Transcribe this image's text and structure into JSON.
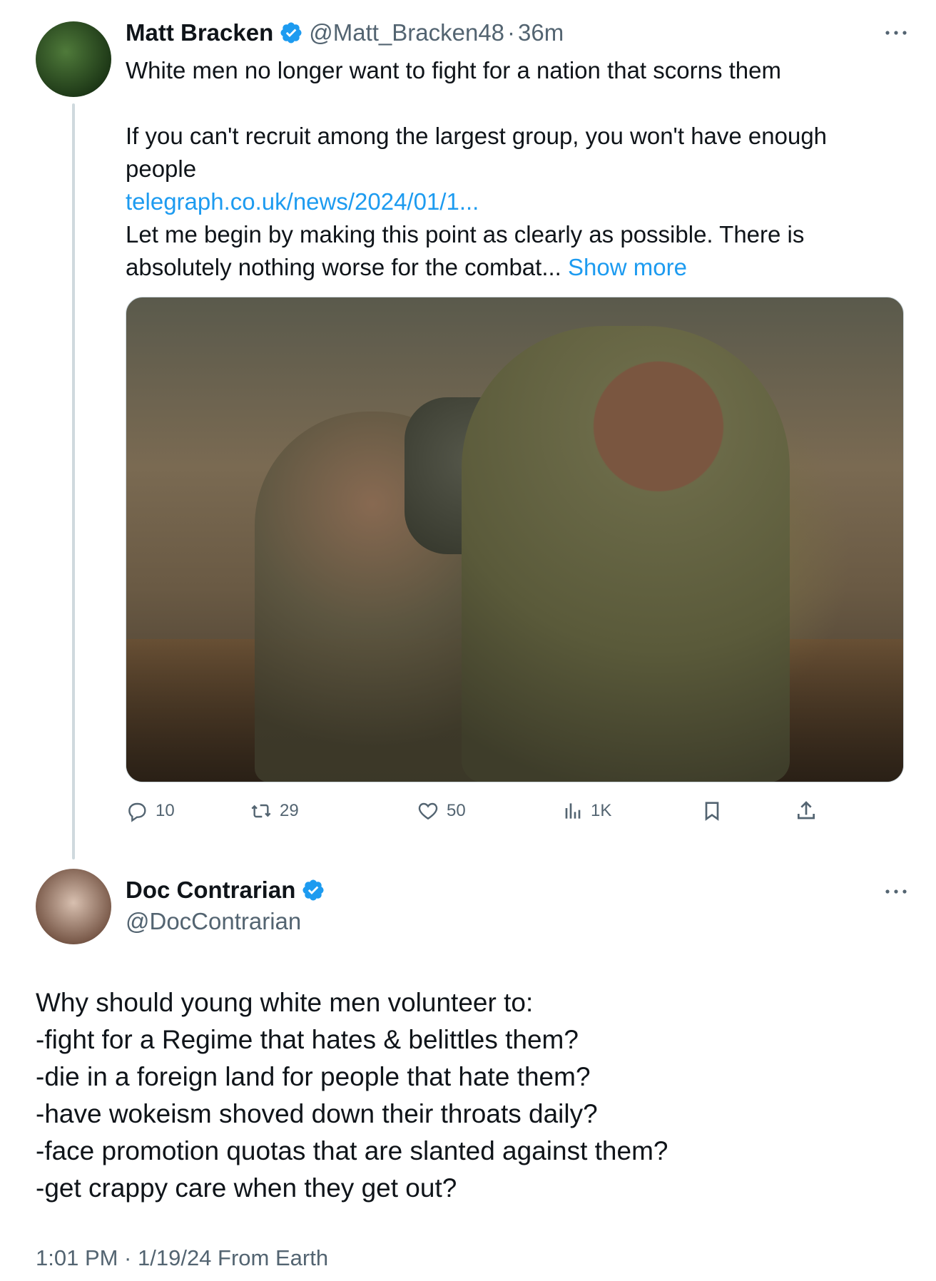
{
  "tweet1": {
    "author_name": "Matt Bracken",
    "handle": "@Matt_Bracken48",
    "separator": "·",
    "time": "36m",
    "line1": "White men no longer want to fight for a nation that scorns them",
    "line2": "If you can't recruit among the largest group, you won't have enough people",
    "link": "telegraph.co.uk/news/2024/01/1...",
    "excerpt": "Let me begin by making this point as clearly as possible. There is absolutely nothing worse for the combat...",
    "show_more": "Show more",
    "actions": {
      "replies": "10",
      "reposts": "29",
      "likes": "50",
      "views": "1K"
    }
  },
  "tweet2": {
    "author_name": "Doc Contrarian",
    "handle": "@DocContrarian",
    "lines": [
      "Why should young white men volunteer to:",
      "-fight for a Regime that hates & belittles them?",
      "-die in a foreign land for people that hate them?",
      "-have wokeism shoved down their throats daily?",
      "-face promotion quotas that are slanted against them?",
      "-get crappy care when they get out?"
    ],
    "meta": "1:01 PM · 1/19/24 From Earth"
  },
  "icons": [
    "more-icon",
    "verified-badge-icon",
    "reply-icon",
    "repost-icon",
    "like-icon",
    "views-icon",
    "bookmark-icon",
    "share-icon"
  ],
  "colors": {
    "link": "#1d9bf0",
    "verified": "#1d9bf0",
    "secondary_text": "#536471",
    "thread_line": "#cfd9de"
  }
}
